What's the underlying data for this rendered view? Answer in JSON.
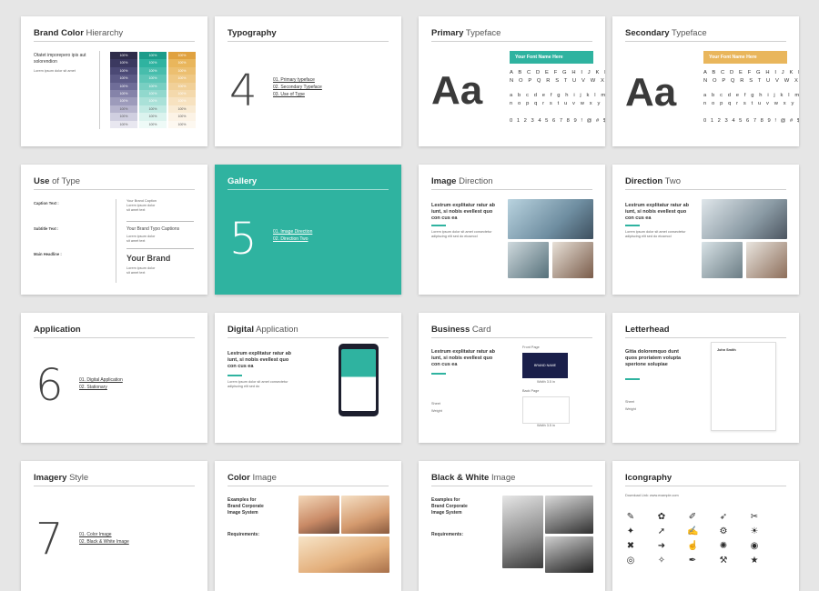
{
  "colors": {
    "teal": "#2fb3a0",
    "navy": "#2e2c4a",
    "gold": "#e9b65c"
  },
  "slides": {
    "brand_color": {
      "title_bold": "Brand Color",
      "title_rest": "Hierarchy",
      "text": "Otatet imporepero ipis aut solorendion",
      "cell": "100%"
    },
    "typography": {
      "title_bold": "Typography",
      "number": "4",
      "items": [
        "01. Primary typeface",
        "02. Secondary Typeface",
        "03. Use of Type"
      ]
    },
    "primary": {
      "title_bold": "Primary",
      "title_rest": "Typeface",
      "aa": "Aa",
      "font_name": "Your Font Name Here",
      "upper": "A B C D E F G H I J K L M",
      "upper2": "N O P Q R S T U V W X Y Z",
      "lower": "a b c d e f g h i j k l m",
      "lower2": "n o p q r s t u v w x y z",
      "digits": "0 1 2 3 4 5 6 7 8 9 ! @ # $"
    },
    "secondary": {
      "title_bold": "Secondary",
      "title_rest": "Typeface",
      "aa": "Aa",
      "font_name": "Your Font Name Here"
    },
    "use_of_type": {
      "title_bold": "Use",
      "title_rest": "of Type",
      "caption": "Caption Text :",
      "subtitle": "Subtitle Text :",
      "headline": "Main Headline :",
      "caption_sample": "Your Brand Typo Captions",
      "headline_sample": "Your Brand"
    },
    "gallery": {
      "title_bold": "Gallery",
      "number": "5",
      "items": [
        "01. Image Direction",
        "02. Direction Two"
      ]
    },
    "image_direction": {
      "title_bold": "Image",
      "title_rest": "Direction",
      "text": "Lestrum explitatur ratur ab iunt, si nobis evellest quo con cus ea"
    },
    "direction_two": {
      "title_bold": "Direction",
      "title_rest": "Two",
      "text": "Lestrum explitatur ratur ab iunt, si nobis evellest quo con cus ea"
    },
    "application": {
      "title_bold": "Application",
      "number": "6",
      "items": [
        "01. Digital Application",
        "02. Stationary"
      ]
    },
    "digital": {
      "title_bold": "Digital",
      "title_rest": "Application",
      "text": "Lestrum explitatur ratur ab iunt, si nobis evellest quo con cus ea"
    },
    "business": {
      "title_bold": "Business",
      "title_rest": "Card",
      "text": "Lestrum explitatur ratur ab iunt, si nobis evellest quo con cus ea",
      "front": "Front Page",
      "back": "Back Page",
      "brand": "BRAND NAME",
      "width": "Width 3.5 in",
      "sheet": "Sheet",
      "weight": "Weight"
    },
    "letterhead": {
      "title_bold": "Letterhead",
      "text": "Gitia doloremquo dunt quos proriatem volupta sperione solupiae",
      "name": "John Smith",
      "sheet": "Sheet",
      "weight": "Weight"
    },
    "imagery": {
      "title_bold": "Imagery",
      "title_rest": "Style",
      "number": "7",
      "items": [
        "01. Color Image",
        "02. Black & White Image"
      ]
    },
    "color_image": {
      "title_bold": "Color",
      "title_rest": "Image",
      "text": "Examples for Brand Corporate Image System",
      "req": "Requirements:"
    },
    "bw_image": {
      "title_bold": "Black & White",
      "title_rest": "Image",
      "text": "Examples for Brand Corporate Image System",
      "req": "Requirements:"
    },
    "icongraphy": {
      "title_bold": "Icongraphy",
      "download": "Download Link: www.example.com",
      "icons": [
        "brush-icon",
        "palette-icon",
        "pencil-icon",
        "rocket-icon",
        "tools-icon",
        "paint-icon",
        "rocket-icon-2",
        "edit-icon",
        "gear-icon",
        "bulb-icon",
        "crossed-tools-icon",
        "arrow-icon",
        "hand-icon",
        "idea-icon",
        "eye-icon",
        "target-icon",
        "compass-icon",
        "pen-icon",
        "brush-tools-icon",
        "star-icon"
      ]
    }
  }
}
